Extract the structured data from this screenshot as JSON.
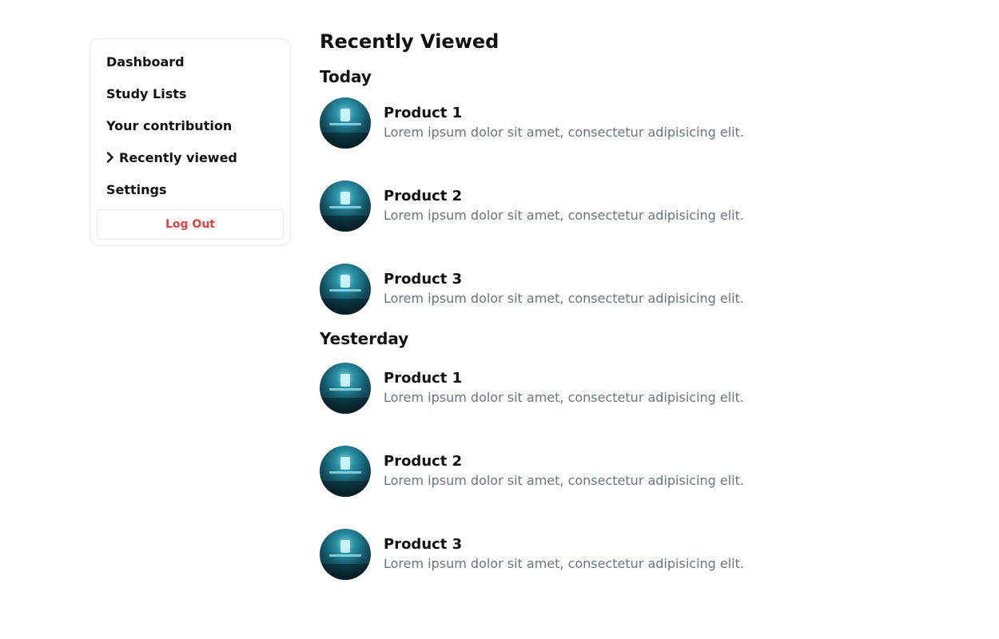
{
  "sidebar": {
    "items": [
      {
        "label": "Dashboard",
        "active": false
      },
      {
        "label": "Study Lists",
        "active": false
      },
      {
        "label": "Your contribution",
        "active": false
      },
      {
        "label": "Recently viewed",
        "active": true
      },
      {
        "label": "Settings",
        "active": false
      }
    ],
    "logout_label": "Log Out"
  },
  "main": {
    "title": "Recently Viewed",
    "sections": [
      {
        "title": "Today",
        "items": [
          {
            "name": "Product 1",
            "description": "Lorem ipsum dolor sit amet, consectetur adipisicing elit."
          },
          {
            "name": "Product 2",
            "description": "Lorem ipsum dolor sit amet, consectetur adipisicing elit."
          },
          {
            "name": "Product 3",
            "description": "Lorem ipsum dolor sit amet, consectetur adipisicing elit."
          }
        ]
      },
      {
        "title": "Yesterday",
        "items": [
          {
            "name": "Product 1",
            "description": "Lorem ipsum dolor sit amet, consectetur adipisicing elit."
          },
          {
            "name": "Product 2",
            "description": "Lorem ipsum dolor sit amet, consectetur adipisicing elit."
          },
          {
            "name": "Product 3",
            "description": "Lorem ipsum dolor sit amet, consectetur adipisicing elit."
          }
        ]
      }
    ]
  },
  "colors": {
    "logout": "#e53e3e",
    "muted_text": "#6b7280",
    "border": "#e5e7eb"
  },
  "icons": {
    "active_indicator": "chevron-right-icon"
  }
}
